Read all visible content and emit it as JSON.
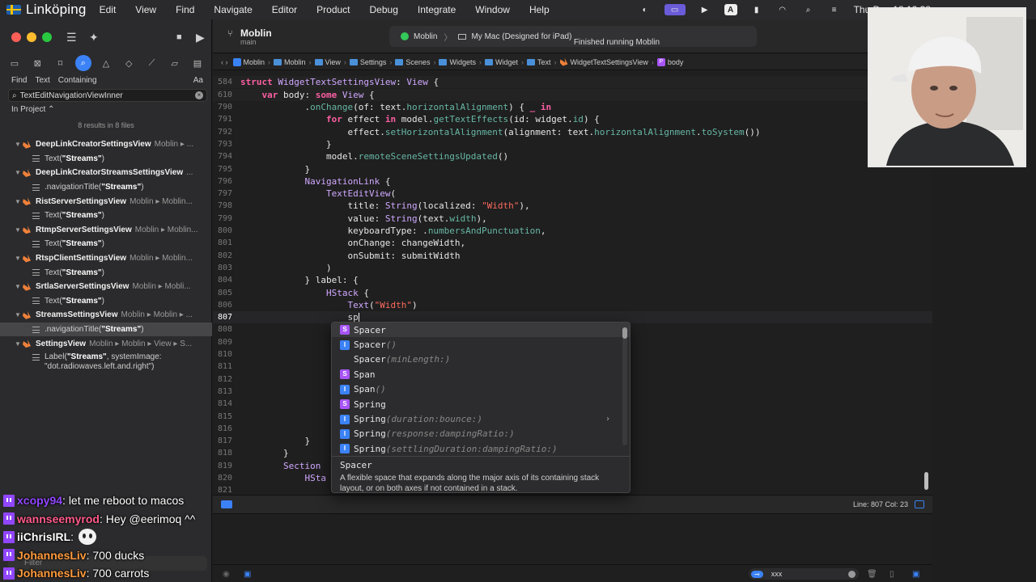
{
  "menubar": {
    "city": "Linköping",
    "items": [
      "Edit",
      "View",
      "Find",
      "Navigate",
      "Editor",
      "Product",
      "Debug",
      "Integrate",
      "Window",
      "Help"
    ],
    "clock": "Thu Dec 18  12:38"
  },
  "toolbar": {
    "scheme_name": "Moblin",
    "scheme_branch": "main",
    "run_target": "Moblin",
    "run_destination": "My Mac (Designed for iPad)",
    "status": "Finished running Moblin"
  },
  "jumpbar": {
    "crumbs": [
      "Moblin",
      "Moblin",
      "View",
      "Settings",
      "Scenes",
      "Widgets",
      "Widget",
      "Text",
      "WidgetTextSettingsView",
      "body"
    ]
  },
  "find": {
    "mode_find": "Find",
    "mode_text": "Text",
    "mode_containing": "Containing",
    "case": "Aa",
    "query": "TextEditNavigationViewInner",
    "scope": "In Project",
    "summary": "8 results in 8 files"
  },
  "results": [
    {
      "title": "DeepLinkCreatorSettingsView",
      "path": "Moblin ▸ ...",
      "pre": "Text(",
      "match": "\"Streams\"",
      "post": ")"
    },
    {
      "title": "DeepLinkCreatorStreamsSettingsView",
      "path": "...",
      "pre": ".navigationTitle(",
      "match": "\"Streams\"",
      "post": ")"
    },
    {
      "title": "RistServerSettingsView",
      "path": "Moblin ▸ Moblin...",
      "pre": "Text(",
      "match": "\"Streams\"",
      "post": ")"
    },
    {
      "title": "RtmpServerSettingsView",
      "path": "Moblin ▸ Moblin...",
      "pre": "Text(",
      "match": "\"Streams\"",
      "post": ")"
    },
    {
      "title": "RtspClientSettingsView",
      "path": "Moblin ▸ Moblin...",
      "pre": "Text(",
      "match": "\"Streams\"",
      "post": ")"
    },
    {
      "title": "SrtlaServerSettingsView",
      "path": "Moblin ▸ Mobli...",
      "pre": "Text(",
      "match": "\"Streams\"",
      "post": ")"
    },
    {
      "title": "StreamsSettingsView",
      "path": "Moblin ▸ Moblin ▸ ...",
      "pre": ".navigationTitle(",
      "match": "\"Streams\"",
      "post": ")"
    },
    {
      "title": "SettingsView",
      "path": "Moblin ▸ Moblin ▸ View ▸ S...",
      "pre": "Label(",
      "match": "\"Streams\"",
      "post": ", systemImage: \"dot.radiowaves.left.and.right\")"
    }
  ],
  "sidebar_filter": "Filter",
  "editor": {
    "sticky": [
      {
        "ln": "584",
        "code": "struct WidgetTextSettingsView: View {"
      },
      {
        "ln": "610",
        "code": "    var body: some View {"
      }
    ],
    "lines": [
      {
        "ln": "790",
        "code": "            .onChange(of: text.horizontalAlignment) { _ in"
      },
      {
        "ln": "791",
        "code": "                for effect in model.getTextEffects(id: widget.id) {"
      },
      {
        "ln": "792",
        "code": "                    effect.setHorizontalAlignment(alignment: text.horizontalAlignment.toSystem())"
      },
      {
        "ln": "793",
        "code": "                }"
      },
      {
        "ln": "794",
        "code": "                model.remoteSceneSettingsUpdated()"
      },
      {
        "ln": "795",
        "code": "            }"
      },
      {
        "ln": "796",
        "code": "            NavigationLink {"
      },
      {
        "ln": "797",
        "code": "                TextEditView("
      },
      {
        "ln": "798",
        "code": "                    title: String(localized: \"Width\"),"
      },
      {
        "ln": "799",
        "code": "                    value: String(text.width),"
      },
      {
        "ln": "800",
        "code": "                    keyboardType: .numbersAndPunctuation,"
      },
      {
        "ln": "801",
        "code": "                    onChange: changeWidth,"
      },
      {
        "ln": "802",
        "code": "                    onSubmit: submitWidth"
      },
      {
        "ln": "803",
        "code": "                )"
      },
      {
        "ln": "804",
        "code": "            } label: {"
      },
      {
        "ln": "805",
        "code": "                HStack {"
      },
      {
        "ln": "806",
        "code": "                    Text(\"Width\")"
      },
      {
        "ln": "807",
        "code": "                    sp"
      },
      {
        "ln": "808",
        "code": ""
      },
      {
        "ln": "809",
        "code": ""
      },
      {
        "ln": "810",
        "code": ""
      },
      {
        "ln": "811",
        "code": ""
      },
      {
        "ln": "812",
        "code": ""
      },
      {
        "ln": "813",
        "code": ""
      },
      {
        "ln": "814",
        "code": ""
      },
      {
        "ln": "815",
        "code": ""
      },
      {
        "ln": "816",
        "code": ""
      },
      {
        "ln": "817",
        "code": "            }"
      },
      {
        "ln": "818",
        "code": "        }"
      },
      {
        "ln": "819",
        "code": "        Section"
      },
      {
        "ln": "820",
        "code": "            HSta"
      },
      {
        "ln": "821",
        "code": ""
      }
    ]
  },
  "completion": {
    "items": [
      {
        "kind": "S",
        "name": "Spacer",
        "args": ""
      },
      {
        "kind": "I",
        "name": "Spacer",
        "args": "()"
      },
      {
        "kind": "",
        "name": "Spacer",
        "args": "(minLength:)"
      },
      {
        "kind": "S",
        "name": "Span",
        "args": ""
      },
      {
        "kind": "I",
        "name": "Span",
        "args": "()"
      },
      {
        "kind": "S",
        "name": "Spring",
        "args": ""
      },
      {
        "kind": "I",
        "name": "Spring",
        "args": "(duration:bounce:)"
      },
      {
        "kind": "I",
        "name": "Spring",
        "args": "(response:dampingRatio:)"
      },
      {
        "kind": "I",
        "name": "Spring",
        "args": "(settlingDuration:dampingRatio:)"
      }
    ],
    "doc_title": "Spacer",
    "doc_body": "A flexible space that expands along the major axis of its containing stack layout, or on both axes if not contained in a stack."
  },
  "status": {
    "line_col": "Line: 807  Col: 23"
  },
  "console": {
    "filter_tag": "⊸",
    "filter_value": "xxx"
  },
  "chat": [
    {
      "user": "xcopy94",
      "msg": ": let me reboot to macos",
      "user_color": "#9146ff"
    },
    {
      "user": "wannseemyrod",
      "msg": ": Hey @eerimoq ^^",
      "user_color": "#ff5a8a"
    },
    {
      "user": "iiChrisIRL",
      "msg": ":",
      "user_color": "#ffffff",
      "emote": true
    },
    {
      "user": "JohannesLiv",
      "msg": ": 700 ducks",
      "user_color": "#ff9a3c"
    },
    {
      "user": "JohannesLiv",
      "msg": ": 700 carrots",
      "user_color": "#ff9a3c"
    }
  ]
}
